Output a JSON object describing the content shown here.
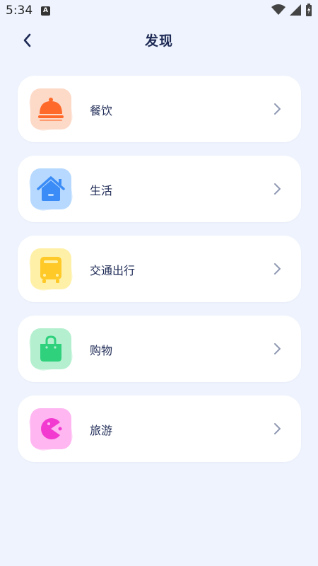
{
  "status_bar": {
    "time": "5:34",
    "notification_icon": "a-badge-icon",
    "wifi_icon": "wifi-icon",
    "signal_icon": "cell-signal-icon",
    "battery_icon": "battery-charging-icon"
  },
  "header": {
    "title": "发现",
    "back_icon": "chevron-left-icon"
  },
  "categories": [
    {
      "label": "餐饮",
      "icon": "food-cloche-icon",
      "bg": "#fdd9c7",
      "accent": "#ff6a2b"
    },
    {
      "label": "生活",
      "icon": "house-icon",
      "bg": "#b7d9ff",
      "accent": "#3b8cf6"
    },
    {
      "label": "交通出行",
      "icon": "bus-icon",
      "bg": "#fff0a8",
      "accent": "#ffc928"
    },
    {
      "label": "购物",
      "icon": "shopping-bag-icon",
      "bg": "#b4f0cf",
      "accent": "#2fd17d"
    },
    {
      "label": "旅游",
      "icon": "pacman-icon",
      "bg": "#ffb6f1",
      "accent": "#f23ad1"
    }
  ],
  "colors": {
    "background": "#eef3fd",
    "title": "#1e2a55",
    "chevron": "#8f99b3"
  }
}
